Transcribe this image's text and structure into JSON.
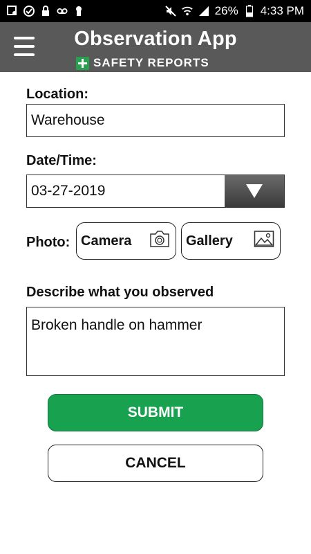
{
  "status_bar": {
    "battery": "26%",
    "time": "4:33 PM",
    "left_icons": [
      "notification-icon",
      "check-circle-icon",
      "lock-icon",
      "voicemail-icon",
      "keyhole-icon"
    ],
    "right_icons": [
      "mute-icon",
      "wifi-icon",
      "signal-icon",
      "battery-icon"
    ]
  },
  "header": {
    "title": "Observation App",
    "subtitle": "SAFETY REPORTS"
  },
  "form": {
    "location_label": "Location:",
    "location_value": "Warehouse",
    "datetime_label": "Date/Time:",
    "datetime_value": "03-27-2019",
    "photo_label": "Photo:",
    "camera_label": "Camera",
    "gallery_label": "Gallery",
    "describe_label": "Describe what you observed",
    "describe_value": "Broken handle on hammer"
  },
  "actions": {
    "submit_label": "SUBMIT",
    "cancel_label": "CANCEL"
  },
  "colors": {
    "header_bg": "#595959",
    "accent_green": "#18a14f",
    "status_bar_bg": "#000000"
  }
}
